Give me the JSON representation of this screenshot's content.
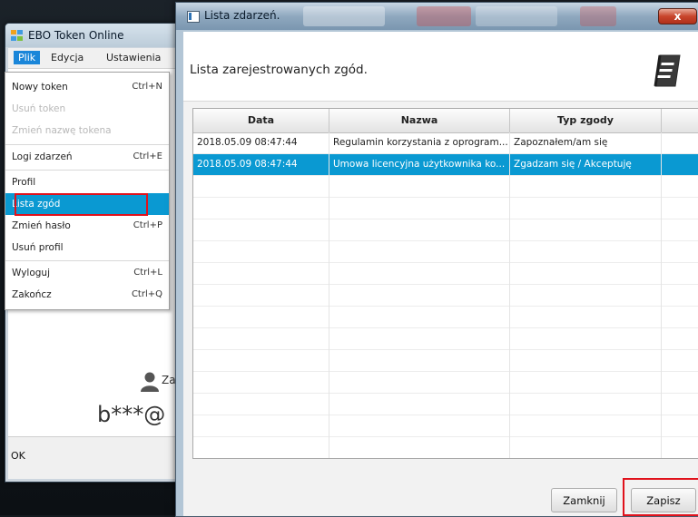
{
  "main_window": {
    "title": "EBO Token Online",
    "menubar": [
      "Plik",
      "Edycja",
      "Ustawienia"
    ],
    "menu": [
      {
        "label": "Nowy token",
        "shortcut": "Ctrl+N",
        "disabled": false
      },
      {
        "label": "Usuń token",
        "shortcut": "",
        "disabled": true
      },
      {
        "label": "Zmień nazwę tokena",
        "shortcut": "",
        "disabled": true
      },
      {
        "label": "Logi zdarzeń",
        "shortcut": "Ctrl+E",
        "disabled": false
      },
      {
        "label": "Profil",
        "shortcut": "",
        "disabled": false
      },
      {
        "label": "Lista zgód",
        "shortcut": "",
        "disabled": false,
        "selected": true
      },
      {
        "label": "Zmień hasło",
        "shortcut": "Ctrl+P",
        "disabled": false
      },
      {
        "label": "Usuń profil",
        "shortcut": "",
        "disabled": false
      },
      {
        "label": "Wyloguj",
        "shortcut": "Ctrl+L",
        "disabled": false
      },
      {
        "label": "Zakończ",
        "shortcut": "Ctrl+Q",
        "disabled": false
      }
    ],
    "profile_partial_label": "Zalo",
    "masked_login": "b***@",
    "status": "OK"
  },
  "dialog": {
    "title": "Lista zdarzeń.",
    "close_label": "x",
    "heading": "Lista zarejestrowanych zgód.",
    "columns": [
      "Data",
      "Nazwa",
      "Typ zgody",
      ""
    ],
    "rows": [
      {
        "data": "2018.05.09 08:47:44",
        "nazwa": "Regulamin korzystania z oprogram...",
        "typ": "Zapoznałem/am się",
        "selected": false
      },
      {
        "data": "2018.05.09 08:47:44",
        "nazwa": "Umowa licencyjna użytkownika ko...",
        "typ": "Zgadzam się / Akceptuję",
        "selected": true
      }
    ],
    "buttons": {
      "close": "Zamknij",
      "save": "Zapisz"
    }
  },
  "colors": {
    "selection": "#0a99d2",
    "highlight": "#e0121c",
    "menu_active": "#1a86d9"
  },
  "icons": [
    "app-icon",
    "book-icon",
    "user-icon",
    "close-icon"
  ]
}
